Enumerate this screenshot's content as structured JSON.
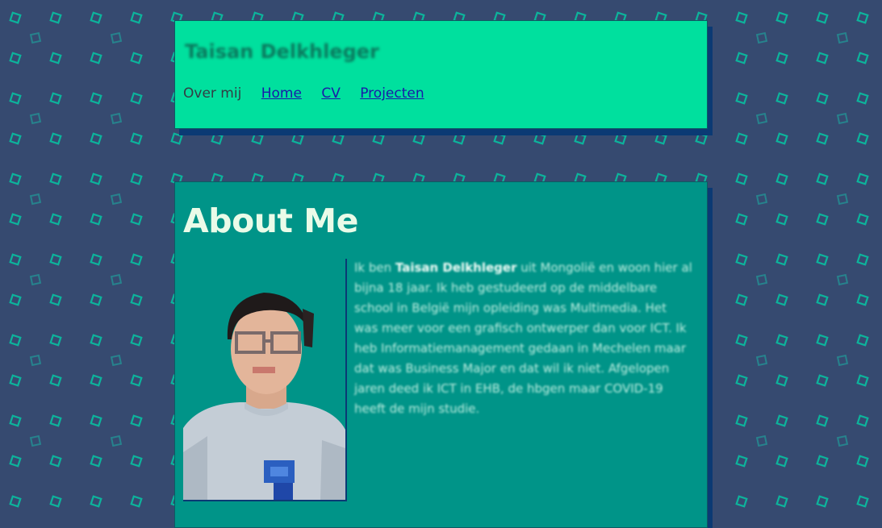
{
  "header": {
    "site_title": "Taisan Delkhleger",
    "nav": {
      "current": "Over mij",
      "links": [
        "Home",
        "CV",
        "Projecten"
      ]
    }
  },
  "about": {
    "title": "About Me",
    "bio": {
      "intro": "Ik ben ",
      "name": "Taisan Delkhleger",
      "text": " uit Mongolië en woon hier al bijna 18 jaar. Ik heb gestudeerd op de middelbare school in België mijn opleiding was Multimedia. Het was meer voor een grafisch ontwerper dan voor ICT. Ik heb Informatiemanagement gedaan in Mechelen maar dat was Business Major en dat wil ik niet. Afgelopen jaren deed ik ICT in EHB, de hbgen maar COVID-19 heeft de mijn studie."
    }
  },
  "colors": {
    "page_bg": "#364a70",
    "pattern": "#00d2a8",
    "header_bg": "#00e09e",
    "about_bg": "#009488",
    "shadow": "#0b3a74",
    "title_text": "#eafbe8",
    "link": "#1a1aa8"
  }
}
